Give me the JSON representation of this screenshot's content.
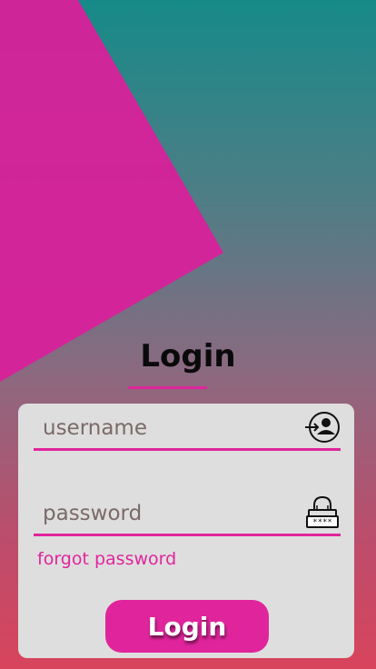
{
  "header": {
    "title": "Login"
  },
  "form": {
    "username": {
      "placeholder": "username",
      "value": ""
    },
    "password": {
      "placeholder": "password",
      "value": ""
    },
    "forgot_label": "forgot password",
    "submit_label": "Login"
  },
  "icons": {
    "username": "login-user-icon",
    "password": "password-lock-icon"
  },
  "colors": {
    "accent": "#e0259c",
    "card": "#dedede",
    "gradient_top": "#168a88",
    "gradient_bottom": "#d8445c",
    "shape": "#d8219a"
  }
}
